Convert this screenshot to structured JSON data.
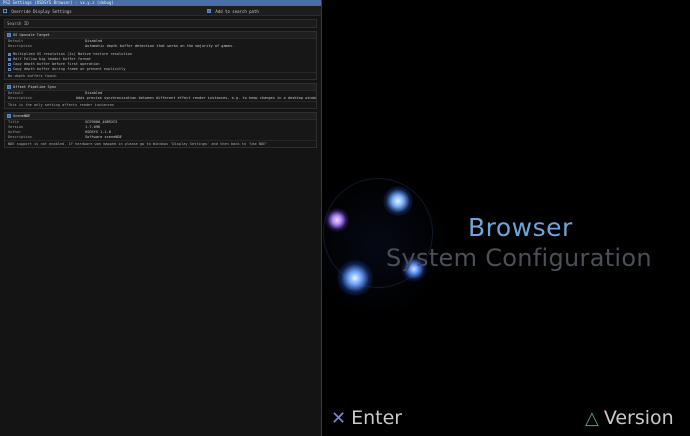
{
  "debug_panel": {
    "title": "PS2 Settings (OSDSYS Browser) - vx.y.z (debug)",
    "top_bar": {
      "left_option": "Override Display Settings",
      "right_option": "Add to search path"
    },
    "search": {
      "label": "Search ID"
    },
    "sections": [
      {
        "header": "GS Upscale Target",
        "fields": [
          {
            "key": "Default",
            "value": "Disabled"
          },
          {
            "key": "Description",
            "value": "Automatic depth buffer detection that works on the majority of games."
          }
        ],
        "rows": [
          "Multiplied GS resolution (1x)  Native texture resolution",
          "Half  Follow big header buffer format",
          "Copy depth buffer before first operation",
          "Copy depth buffer during frame on present explicitly"
        ],
        "note": "No depth buffers found."
      },
      {
        "header": "Offset Pipeline Sync",
        "fields": [
          {
            "key": "Default",
            "value": "Disabled"
          },
          {
            "key": "Description",
            "value": "Adds precise synchronization between different effect render instances, e.g. to keep changes in a desktop window reflect to PS"
          }
        ],
        "rows": [],
        "note": "This is the only setting affects render instances"
      },
      {
        "header": "SceneNDE",
        "fields": [
          {
            "key": "Title",
            "value": "SCE9000_40B92C5"
          },
          {
            "key": "Version",
            "value": "1.7.096"
          },
          {
            "key": "Author",
            "value": "OSDSYS 1.1.0"
          },
          {
            "key": "Description",
            "value": "Software sceneNDE"
          }
        ],
        "rows": [],
        "note": "NDE support is not enabled. If hardware was mapped in please go to Windows 'Display Settings' and then back to 'Use NDE'"
      }
    ]
  },
  "ps2_screen": {
    "title": "Browser",
    "subtitle": "System Configuration",
    "hints": [
      {
        "icon": "cross-icon",
        "glyph": "✕",
        "label": "Enter",
        "color": "#7f86c8"
      },
      {
        "icon": "triangle-icon",
        "glyph": "△",
        "label": "Version",
        "color": "#3fae7e"
      }
    ]
  }
}
